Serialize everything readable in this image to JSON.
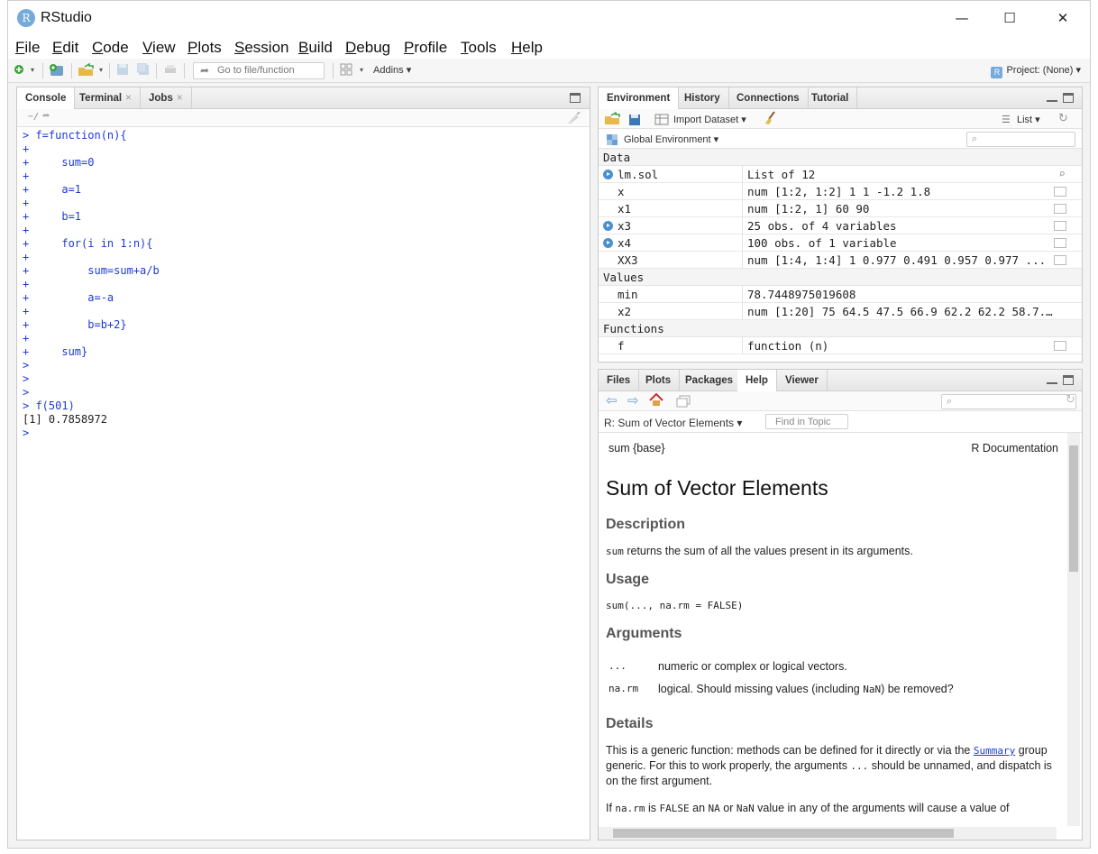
{
  "window": {
    "title": "RStudio",
    "logo_letter": "R",
    "minimize_glyph": "—",
    "maximize_glyph": "☐",
    "close_glyph": "✕"
  },
  "menu": [
    {
      "first": "F",
      "rest": "ile"
    },
    {
      "first": "E",
      "rest": "dit"
    },
    {
      "first": "C",
      "rest": "ode"
    },
    {
      "first": "V",
      "rest": "iew"
    },
    {
      "first": "P",
      "rest": "lots"
    },
    {
      "first": "S",
      "rest": "ession"
    },
    {
      "first": "B",
      "rest": "uild"
    },
    {
      "first": "D",
      "rest": "ebug"
    },
    {
      "first": "P",
      "rest": "rofile"
    },
    {
      "first": "T",
      "rest": "ools"
    },
    {
      "first": "H",
      "rest": "elp"
    }
  ],
  "toolbar": {
    "goto_placeholder": "Go to file/function",
    "addins": "Addins ▾",
    "project": "Project: (None) ▾",
    "project_logo": "R"
  },
  "console": {
    "tabs": [
      "Console",
      "Terminal",
      "Jobs"
    ],
    "path": "~/",
    "lines": [
      {
        "p": ">",
        "t": " f=function(n){",
        "k": "code"
      },
      {
        "p": "+",
        "t": "",
        "k": "code"
      },
      {
        "p": "+",
        "t": "     sum=0",
        "k": "code"
      },
      {
        "p": "+",
        "t": "",
        "k": "code"
      },
      {
        "p": "+",
        "t": "     a=1",
        "k": "code"
      },
      {
        "p": "+",
        "t": "",
        "k": "code"
      },
      {
        "p": "+",
        "t": "     b=1",
        "k": "code"
      },
      {
        "p": "+",
        "t": "",
        "k": "code"
      },
      {
        "p": "+",
        "t": "     for(i in 1:n){",
        "k": "code"
      },
      {
        "p": "+",
        "t": "",
        "k": "code"
      },
      {
        "p": "+",
        "t": "         sum=sum+a/b",
        "k": "code"
      },
      {
        "p": "+",
        "t": "",
        "k": "code"
      },
      {
        "p": "+",
        "t": "         a=-a",
        "k": "code"
      },
      {
        "p": "+",
        "t": "",
        "k": "code"
      },
      {
        "p": "+",
        "t": "         b=b+2}",
        "k": "code"
      },
      {
        "p": "+",
        "t": "",
        "k": "code"
      },
      {
        "p": "+",
        "t": "     sum}",
        "k": "code"
      },
      {
        "p": ">",
        "t": "",
        "k": "code"
      },
      {
        "p": ">",
        "t": "",
        "k": "code"
      },
      {
        "p": ">",
        "t": "",
        "k": "code"
      },
      {
        "p": ">",
        "t": " f(501)",
        "k": "code"
      },
      {
        "p": "",
        "t": "[1] 0.7858972",
        "k": "out"
      },
      {
        "p": ">",
        "t": "",
        "k": "code"
      }
    ]
  },
  "environment": {
    "tabs": [
      "Environment",
      "History",
      "Connections",
      "Tutorial"
    ],
    "import_label": "Import Dataset ▾",
    "list_label": "List ▾",
    "scope_label": "Global Environment ▾",
    "sections": [
      {
        "title": "Data",
        "rows": [
          {
            "name": "lm.sol",
            "value": "List of 12",
            "expand": true,
            "icon": "magnifier-icon"
          },
          {
            "name": "x",
            "value": "num [1:2, 1:2] 1 1 -1.2 1.8",
            "expand": false,
            "icon": "grid-icon"
          },
          {
            "name": "x1",
            "value": "num [1:2, 1] 60 90",
            "expand": false,
            "icon": "grid-icon"
          },
          {
            "name": "x3",
            "value": "25 obs. of 4 variables",
            "expand": true,
            "icon": "grid-icon"
          },
          {
            "name": "x4",
            "value": "100 obs. of 1 variable",
            "expand": true,
            "icon": "grid-icon"
          },
          {
            "name": "XX3",
            "value": "num [1:4, 1:4] 1 0.977 0.491 0.957 0.977 ...",
            "expand": false,
            "icon": "grid-icon"
          }
        ]
      },
      {
        "title": "Values",
        "rows": [
          {
            "name": "min",
            "value": "78.7448975019608",
            "expand": false,
            "icon": ""
          },
          {
            "name": "x2",
            "value": "num [1:20] 75 64.5 47.5 66.9 62.2 62.2 58.7...",
            "expand": false,
            "icon": ""
          }
        ]
      },
      {
        "title": "Functions",
        "rows": [
          {
            "name": "f",
            "value": "function (n)",
            "expand": false,
            "icon": "script-icon"
          }
        ]
      }
    ]
  },
  "help": {
    "tabs": [
      "Files",
      "Plots",
      "Packages",
      "Help",
      "Viewer"
    ],
    "topic_label": "R: Sum of Vector Elements ▾",
    "find_placeholder": "Find in Topic",
    "head_left": "sum {base}",
    "head_right": "R Documentation",
    "title": "Sum of Vector Elements",
    "description_heading": "Description",
    "description_code": "sum",
    "description_text": " returns the sum of all the values present in its arguments.",
    "usage_heading": "Usage",
    "usage_code": "sum(..., na.rm = FALSE)",
    "arguments_heading": "Arguments",
    "args": [
      {
        "name": "...",
        "desc": "numeric or complex or logical vectors."
      },
      {
        "name": "na.rm",
        "desc_pre": "logical. Should missing values (including ",
        "desc_code": "NaN",
        "desc_post": ") be removed?"
      }
    ],
    "details_heading": "Details",
    "details_1a": "This is a generic function: methods can be defined for it directly or via the ",
    "details_link": "Summary",
    "details_1b": " group generic. For this to work properly, the arguments ",
    "details_code": "...",
    "details_1c": " should be unnamed, and dispatch is on the first argument.",
    "details_2a": "If ",
    "details_2b": "na.rm",
    "details_2c": " is ",
    "details_2d": "FALSE",
    "details_2e": " an ",
    "details_2f": "NA",
    "details_2g": " or ",
    "details_2h": "NaN",
    "details_2i": " value in any of the arguments will cause a value of"
  },
  "colors": {
    "accent": "#75aadb",
    "code_blue": "#1d39d8"
  }
}
